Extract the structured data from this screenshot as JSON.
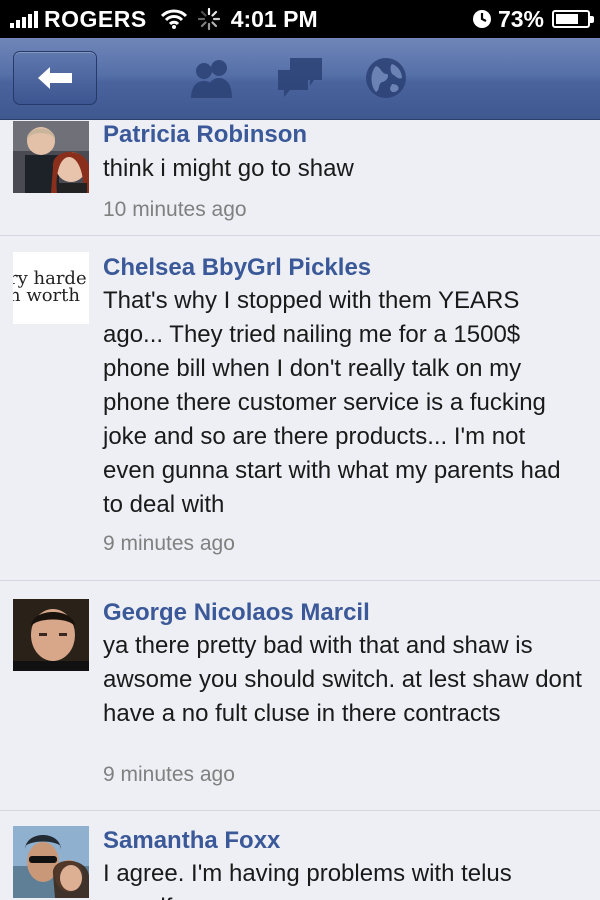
{
  "status_bar": {
    "carrier": "ROGERS",
    "time": "4:01 PM",
    "battery": "73%",
    "battery_level": 0.73
  },
  "nav": {
    "back_icon": "back-arrow-icon",
    "icons": [
      "friend-requests-icon",
      "messages-icon",
      "notifications-globe-icon"
    ]
  },
  "comments": [
    {
      "author": "Patricia Robinson",
      "text": "think i might go to shaw",
      "time": "10 minutes ago"
    },
    {
      "author": "Chelsea BbyGrl Pickles",
      "avatar_text": [
        "ry harde",
        "n worth"
      ],
      "text": "That's why I stopped with them YEARS ago... They tried nailing me for a 1500$ phone bill when I don't really talk on my phone there customer service is a fucking joke and so are there products... I'm not even gunna start with what my parents had to deal with",
      "time": "9 minutes ago"
    },
    {
      "author": "George Nicolaos Marcil",
      "text": "ya there pretty bad with that and shaw is awsome you should switch. at lest shaw dont have a no fult cluse in there contracts",
      "time": "9 minutes ago"
    },
    {
      "author": "Samantha Foxx",
      "text": "I agree. I'm having problems with telus myself",
      "time": ""
    }
  ],
  "colors": {
    "link": "#3b5998",
    "nav_bar": "#4a639d",
    "background": "#edeff4"
  }
}
